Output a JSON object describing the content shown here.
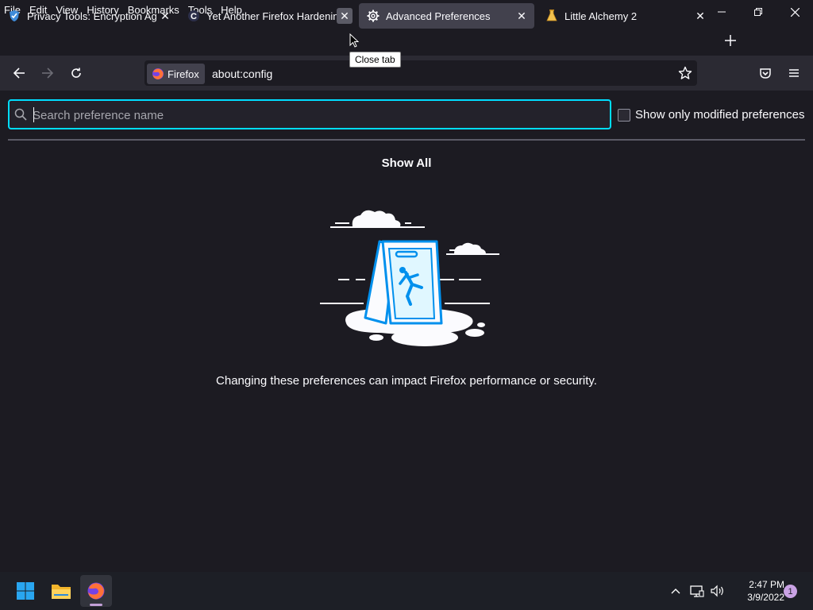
{
  "menubar": {
    "items": [
      {
        "label": "File"
      },
      {
        "label": "Edit"
      },
      {
        "label": "View"
      },
      {
        "label": "History"
      },
      {
        "label": "Bookmarks"
      },
      {
        "label": "Tools"
      },
      {
        "label": "Help"
      }
    ]
  },
  "tabs": [
    {
      "title": "Privacy Tools: Encryption Agains",
      "icon": "privacytools-shield-icon",
      "selected": false
    },
    {
      "title": "Yet Another Firefox Hardening Gu",
      "icon": "c-site-icon",
      "selected": false
    },
    {
      "title": "Advanced Preferences",
      "icon": "gear-icon",
      "selected": true
    },
    {
      "title": "Little Alchemy 2",
      "icon": "flask-icon",
      "selected": false
    }
  ],
  "tooltip": {
    "text": "Close tab"
  },
  "navbar": {
    "identity_label": "Firefox",
    "url": "about:config"
  },
  "config": {
    "search_placeholder": "Search preference name",
    "modified_label": "Show only modified preferences",
    "show_all": "Show All",
    "warning": "Changing these preferences can impact Firefox performance or security."
  },
  "taskbar": {
    "time": "2:47 PM",
    "date": "3/9/2022",
    "notification_count": "1"
  },
  "colors": {
    "accent": "#00ddff",
    "chrome_bg": "#1c1b22",
    "toolbar_bg": "#2b2a33",
    "selected_tab": "#42414d"
  }
}
